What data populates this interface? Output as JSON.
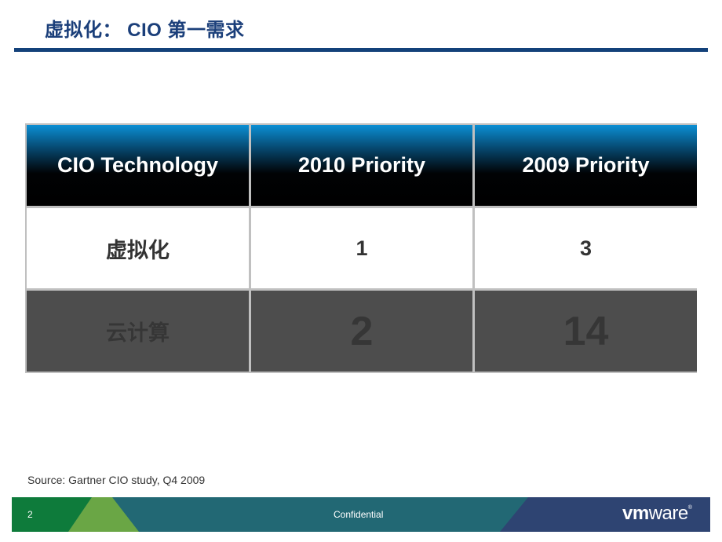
{
  "slide": {
    "title": "虚拟化： CIO 第一需求",
    "page_number": "2",
    "footer_text": "Confidential",
    "logo": {
      "bold": "vm",
      "regular": "ware",
      "mark": "®"
    },
    "source": "Source:  Gartner CIO study, Q4 2009"
  },
  "table": {
    "headers": [
      "CIO Technology",
      "2010 Priority",
      "2009 Priority"
    ],
    "rows": [
      {
        "technology": "虚拟化",
        "priority_2010": "1",
        "priority_2009": "3"
      },
      {
        "technology": "云计算",
        "priority_2010": "2",
        "priority_2009": "14"
      }
    ]
  },
  "colors": {
    "title": "#1b3f7a",
    "rule": "#13417a",
    "footer_green": "#0e7b3b",
    "footer_lightgreen": "#6aa645",
    "footer_teal": "#226874",
    "footer_navy": "#2e4472"
  }
}
